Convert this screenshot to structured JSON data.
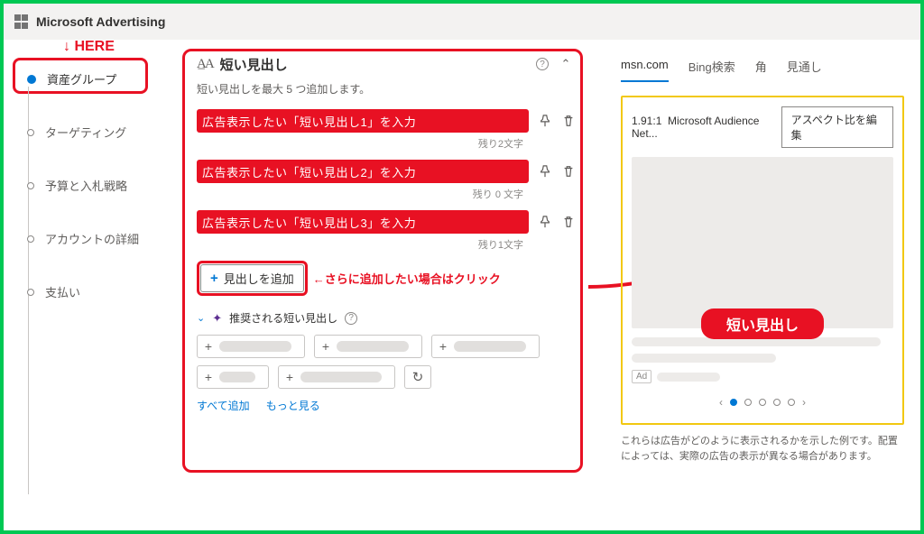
{
  "brand": "Microsoft Advertising",
  "here_label": "↓ HERE",
  "sidebar": {
    "items": [
      {
        "label": "資産グループ",
        "active": true
      },
      {
        "label": "ターゲティング",
        "active": false
      },
      {
        "label": "予算と入札戦略",
        "active": false
      },
      {
        "label": "アカウントの詳細",
        "active": false
      },
      {
        "label": "支払い",
        "active": false
      }
    ]
  },
  "panel": {
    "icon": "A̲A",
    "title": "短い見出し",
    "desc": "短い見出しを最大 5 つ追加します。",
    "inputs": [
      {
        "text": "広告表示したい「短い見出し1」を入力",
        "counter": "残り2文字"
      },
      {
        "text": "広告表示したい「短い見出し2」を入力",
        "counter": "残り 0 文字"
      },
      {
        "text": "広告表示したい「短い見出し3」を入力",
        "counter": "残り1文字"
      }
    ],
    "add_label": "見出しを追加",
    "add_note": "←さらに追加したい場合はクリック",
    "suggest_label": "推奨される短い見出し",
    "link_add_all": "すべて追加",
    "link_more": "もっと見る"
  },
  "preview": {
    "tabs": [
      {
        "label": "msn.com",
        "active": true
      },
      {
        "label": "Bing検索",
        "active": false
      },
      {
        "label": "角",
        "active": false
      },
      {
        "label": "見通し",
        "active": false
      }
    ],
    "ratio": "1.91:1",
    "network": "Microsoft Audience Net...",
    "edit_button": "アスペクト比を編集",
    "headline_badge": "短い見出し",
    "ad_label": "Ad",
    "disclaimer": "これらは広告がどのように表示されるかを示した例です。配置によっては、実際の広告の表示が異なる場合があります。"
  }
}
